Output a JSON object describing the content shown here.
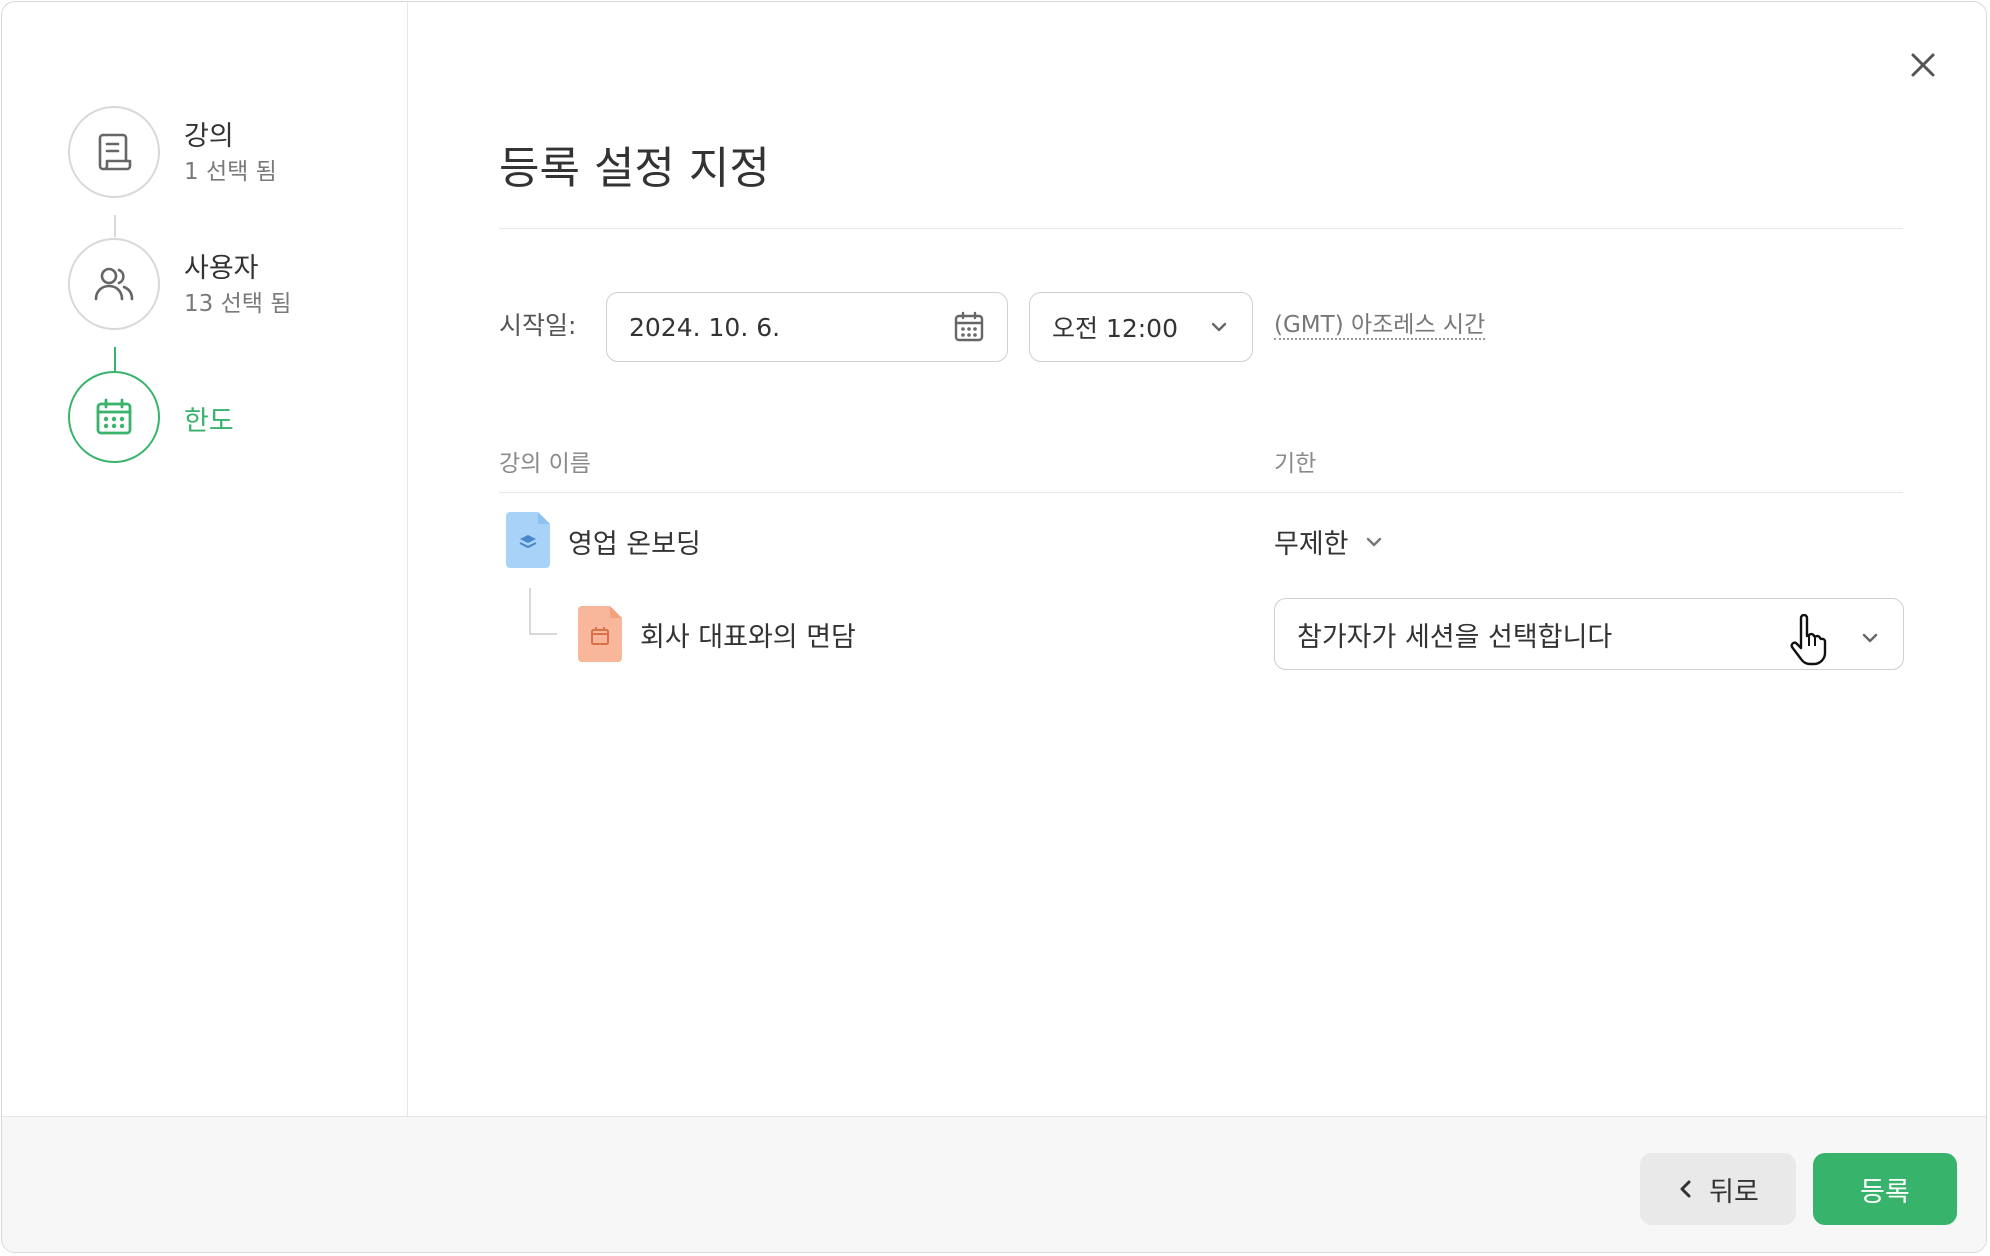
{
  "steps": [
    {
      "title": "강의",
      "subtitle": "1 선택 됨",
      "icon": "document-icon"
    },
    {
      "title": "사용자",
      "subtitle": "13 선택 됨",
      "icon": "users-icon"
    },
    {
      "title": "한도",
      "subtitle": "",
      "icon": "calendar-icon"
    }
  ],
  "main": {
    "title": "등록 설정 지정",
    "start_label": "시작일:",
    "date_value": "2024. 10. 6.",
    "time_value": "오전 12:00",
    "timezone_link": "(GMT) 아조레스 시간",
    "columns": {
      "course_name": "강의 이름",
      "deadline": "기한"
    },
    "courses": [
      {
        "name": "영업 온보딩",
        "deadline": "무제한",
        "icon": "course-file-icon"
      },
      {
        "name": "회사 대표와의 면담",
        "deadline": "참가자가 세션을 선택합니다",
        "icon": "event-file-icon"
      }
    ]
  },
  "footer": {
    "back_label": "뒤로",
    "enroll_label": "등록"
  },
  "colors": {
    "accent": "#37b36b",
    "course_icon": "#a9d2f8",
    "event_icon": "#f8b79a"
  }
}
